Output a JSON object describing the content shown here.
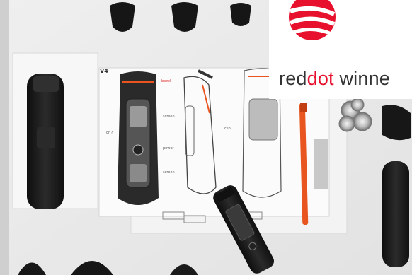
{
  "badge": {
    "brand_red": "reddot",
    "brand_tail": "winne",
    "logo_colors": {
      "red": "#e8112d",
      "white": "#ffffff",
      "text": "#333333"
    }
  },
  "sketch": {
    "version": "V4",
    "annotations": {
      "bezel": "bezel",
      "screen": "screen",
      "power": "power",
      "screen_lower": "screen",
      "clip": "clip",
      "or": "or ?"
    }
  },
  "photo": {
    "subject": "product design sketches of a hair trimmer surrounded by trimmer parts",
    "colors": {
      "background": "#e9e9e9",
      "device": "#1c1c1c",
      "accent": "#e8551f"
    }
  }
}
